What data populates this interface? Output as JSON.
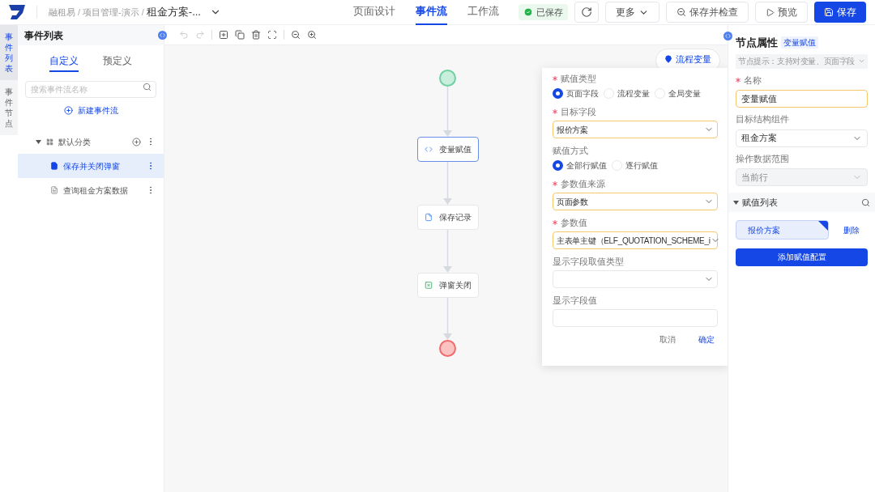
{
  "header": {
    "breadcrumb": [
      {
        "label": "融租易",
        "separator": "/"
      },
      {
        "label": "项目管理-演示",
        "separator": "/"
      }
    ],
    "current_page": "租金方案-...",
    "tabs": [
      {
        "label": "页面设计",
        "selected": false
      },
      {
        "label": "事件流",
        "selected": true
      },
      {
        "label": "工作流",
        "selected": false
      }
    ],
    "status": "已保存",
    "buttons": [
      {
        "kind": "refresh"
      },
      {
        "kind": "more",
        "label": "更多"
      },
      {
        "kind": "check",
        "label": "保存并检查"
      },
      {
        "kind": "preview",
        "label": "预览"
      },
      {
        "kind": "save",
        "label": "保存"
      }
    ]
  },
  "side_tabs": [
    {
      "label": "事件列表",
      "selected": true
    },
    {
      "label": "事件节点",
      "selected": false
    }
  ],
  "event_panel": {
    "title": "事件列表",
    "tabs": [
      {
        "label": "自定义",
        "selected": true
      },
      {
        "label": "预定义",
        "selected": false
      }
    ],
    "search": {
      "placeholder": "搜索事件流名称"
    },
    "new_button": "新建事件流",
    "tree": [
      {
        "label": "默认分类",
        "expanded": true,
        "children": [
          {
            "label": "保存并关闭弹窗",
            "selected": true
          },
          {
            "label": "查询租金方案数据",
            "selected": false
          }
        ]
      }
    ]
  },
  "toolbar": [
    {
      "kind": "undo",
      "disabled": true
    },
    {
      "kind": "redo",
      "disabled": true
    },
    {
      "kind": "add",
      "disabled": false
    },
    {
      "kind": "copy",
      "disabled": false
    },
    {
      "kind": "delete",
      "disabled": false
    },
    {
      "kind": "fit",
      "disabled": false
    },
    {
      "kind": "zoom-out",
      "disabled": false
    },
    {
      "kind": "zoom-in",
      "disabled": false
    }
  ],
  "canvas": {
    "variables_button": "流程变量",
    "nodes": [
      {
        "kind": "start"
      },
      {
        "kind": "assign",
        "label": "变量赋值",
        "selected": true
      },
      {
        "kind": "save",
        "label": "保存记录",
        "selected": false
      },
      {
        "kind": "close",
        "label": "弹窗关闭",
        "selected": false
      },
      {
        "kind": "end"
      }
    ]
  },
  "popup": {
    "fields": [
      {
        "kind": "radio",
        "label": "赋值类型",
        "required": true,
        "options": [
          {
            "label": "页面字段",
            "selected": true
          },
          {
            "label": "流程变量",
            "selected": false
          },
          {
            "label": "全局变量",
            "selected": false
          }
        ]
      },
      {
        "kind": "select",
        "label": "目标字段",
        "required": true,
        "value": "报价方案"
      },
      {
        "kind": "radio",
        "label": "赋值方式",
        "required": false,
        "options": [
          {
            "label": "全部行赋值",
            "selected": true
          },
          {
            "label": "逐行赋值",
            "selected": false
          }
        ]
      },
      {
        "kind": "select",
        "label": "参数值来源",
        "required": true,
        "value": "页面参数"
      },
      {
        "kind": "select",
        "label": "参数值",
        "required": true,
        "value": "主表单主键（ELF_QUOTATION_SCHEME_i"
      },
      {
        "kind": "select",
        "label": "显示字段取值类型",
        "required": false
      },
      {
        "kind": "input",
        "label": "显示字段值",
        "required": false
      }
    ],
    "cancel": "取消",
    "confirm": "确定"
  },
  "properties": {
    "title": "节点属性",
    "tag": "变量赋值",
    "hint": "节点提示：支持对变量、页面字段",
    "fields": [
      {
        "kind": "input",
        "label": "名称",
        "required": true,
        "value": "变量赋值",
        "disabled": false
      },
      {
        "kind": "select",
        "label": "目标结构组件",
        "required": false,
        "value": "租金方案",
        "disabled": false
      },
      {
        "kind": "select",
        "label": "操作数据范围",
        "required": false,
        "value": "当前行",
        "disabled": true
      }
    ],
    "list_section": {
      "title": "赋值列表",
      "expanded": true,
      "items": [
        {
          "label": "报价方案",
          "delete": "删除"
        }
      ],
      "add_button": "添加赋值配置"
    }
  }
}
